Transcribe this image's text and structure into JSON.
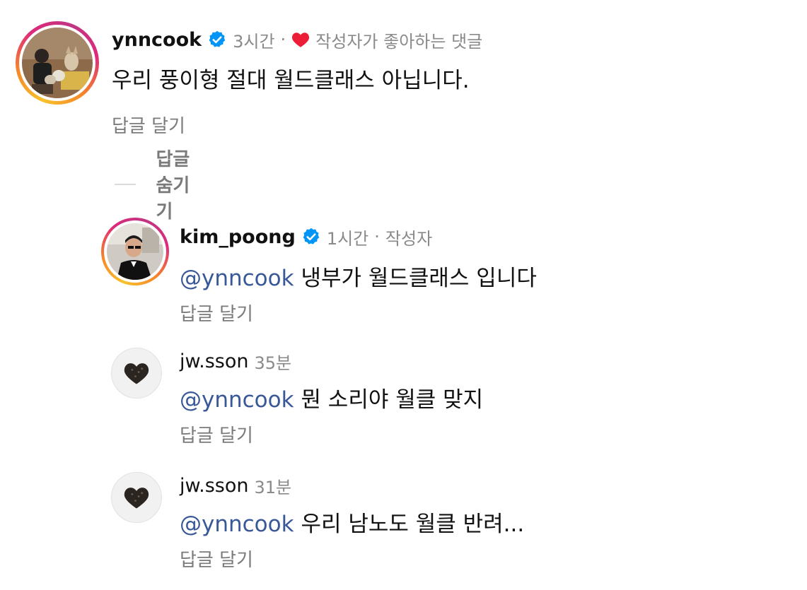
{
  "main_comment": {
    "username": "ynncook",
    "time": "3시간",
    "separator": "·",
    "liked_label": "작성자가 좋아하는 댓글",
    "text": "우리 풍이형 절대 월드클래스 아닙니다.",
    "reply_label": "답글 달기",
    "hide_replies_label": "답글 숨기기"
  },
  "replies": [
    {
      "username": "kim_poong",
      "time": "1시간",
      "separator": "·",
      "role": "작성자",
      "mention": "@ynncook",
      "text": "냉부가 월드클래스 입니다",
      "reply_label": "답글 달기"
    },
    {
      "username": "jw.sson",
      "time": "35분",
      "mention": "@ynncook",
      "text": "뭔 소리야 월클 맞지",
      "reply_label": "답글 달기"
    },
    {
      "username": "jw.sson",
      "time": "31분",
      "mention": "@ynncook",
      "text": "우리 남노도 월클 반려...",
      "reply_label": "답글 달기"
    }
  ],
  "colors": {
    "mention": "#385898",
    "verified": "#0095f6",
    "heart": "#ed1d38",
    "muted": "#8a8a8a"
  },
  "icons": {
    "verified": "verified-badge-icon",
    "heart": "heart-icon",
    "avatar_dark_heart": "dark-heart-icon"
  }
}
